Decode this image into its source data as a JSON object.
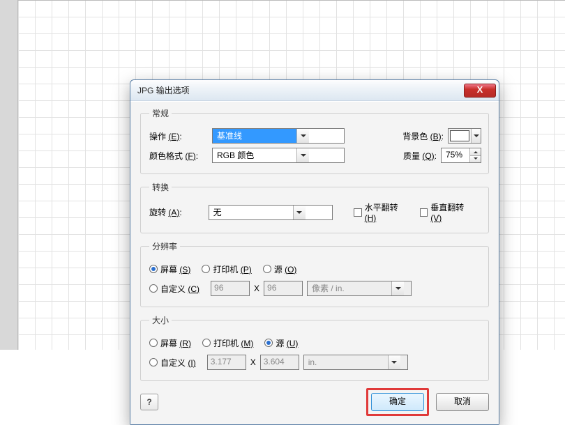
{
  "dialog": {
    "title": "JPG 输出选项",
    "close_icon": "X"
  },
  "general": {
    "legend": "常规",
    "operation_label": "操作",
    "operation_key": "(E)",
    "operation_value": "基准线",
    "color_format_label": "颜色格式",
    "color_format_key": "(F)",
    "color_format_value": "RGB 颜色",
    "bgcolor_label": "背景色",
    "bgcolor_key": "(B)",
    "quality_label": "质量",
    "quality_key": "(Q)",
    "quality_value": "75%"
  },
  "transform": {
    "legend": "转换",
    "rotate_label": "旋转",
    "rotate_key": "(A)",
    "rotate_value": "无",
    "fliph_label": "水平翻转",
    "fliph_key": "(H)",
    "flipv_label": "垂直翻转",
    "flipv_key": "(V)"
  },
  "resolution": {
    "legend": "分辨率",
    "screen": "屏幕",
    "screen_key": "(S)",
    "printer": "打印机",
    "printer_key": "(P)",
    "source": "源",
    "source_key": "(O)",
    "custom": "自定义",
    "custom_key": "(C)",
    "xval": "96",
    "sep": "X",
    "yval": "96",
    "unit": "像素 / in."
  },
  "size": {
    "legend": "大小",
    "screen": "屏幕",
    "screen_key": "(R)",
    "printer": "打印机",
    "printer_key": "(M)",
    "source": "源",
    "source_key": "(U)",
    "custom": "自定义",
    "custom_key": "(I)",
    "xval": "3.177",
    "sep": "X",
    "yval": "3.604",
    "unit": "in."
  },
  "footer": {
    "help": "?",
    "ok": "确定",
    "cancel": "取消"
  }
}
